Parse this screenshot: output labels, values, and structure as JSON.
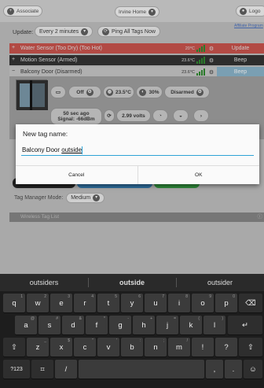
{
  "topbar": {
    "left_label": "Associate",
    "center_label": "Irvine Home",
    "right_label": "Logo"
  },
  "update_row": {
    "label": "Update:",
    "interval": "Every 2 minutes",
    "ping_button": "Ping All Tags Now",
    "link": "Affiliate Program"
  },
  "tags": [
    {
      "name": "Water Sensor (Too Dry) (Too Hot)",
      "temp": "20°C",
      "action": "Update",
      "color": "#b24a44"
    },
    {
      "name": "Motion Sensor (Armed)",
      "temp": "23.6°C",
      "action": "Beep",
      "color": "#2d2d2d"
    },
    {
      "name": "Balcony Door (Disarmed)",
      "temp": "23.6°C",
      "action": "Beep",
      "color": "#b0b0b0"
    }
  ],
  "detail": {
    "off_label": "Off",
    "temp": "23.5°C",
    "humidity": "30%",
    "disarmed": "Disarmed",
    "last_seen": "50 sec ago",
    "signal": "Signal: -66dBm",
    "volts": "2.99 volts"
  },
  "manager_mode": {
    "label": "Tag Manager Mode:",
    "value": "Medium"
  },
  "wireless_list": "Wireless Tag List",
  "dialog": {
    "title": "New tag name:",
    "value_prefix": "Balcony Door ",
    "value_underlined": "outside",
    "cancel": "Cancel",
    "ok": "OK"
  },
  "keyboard": {
    "suggestions": [
      "outsiders",
      "outside",
      "outsider"
    ],
    "row1": [
      {
        "k": "q",
        "h": "1"
      },
      {
        "k": "w",
        "h": "2"
      },
      {
        "k": "e",
        "h": "3"
      },
      {
        "k": "r",
        "h": "4"
      },
      {
        "k": "t",
        "h": "5"
      },
      {
        "k": "y",
        "h": "6"
      },
      {
        "k": "u",
        "h": "7"
      },
      {
        "k": "i",
        "h": "8"
      },
      {
        "k": "o",
        "h": "9"
      },
      {
        "k": "p",
        "h": "0"
      }
    ],
    "row2": [
      {
        "k": "a",
        "h": "@"
      },
      {
        "k": "s",
        "h": "#"
      },
      {
        "k": "d",
        "h": "&"
      },
      {
        "k": "f",
        "h": "*"
      },
      {
        "k": "g",
        "h": "-"
      },
      {
        "k": "h",
        "h": "+"
      },
      {
        "k": "j",
        "h": "="
      },
      {
        "k": "k",
        "h": "("
      },
      {
        "k": "l",
        "h": ")"
      }
    ],
    "row3": [
      {
        "k": "z",
        "h": "_"
      },
      {
        "k": "x",
        "h": "$"
      },
      {
        "k": "c",
        "h": "\""
      },
      {
        "k": "v",
        "h": "'"
      },
      {
        "k": "b",
        "h": ":"
      },
      {
        "k": "n",
        "h": ";"
      },
      {
        "k": "m",
        "h": "/"
      },
      {
        "k": "!",
        "h": ""
      },
      {
        "k": "?",
        "h": ""
      }
    ],
    "sym_label": "?123",
    "tab_label": "⌗",
    "slash_label": "/",
    "comma_label": ",",
    "period_label": ".",
    "shift_glyph": "⇧",
    "backspace_glyph": "⌫",
    "enter_glyph": "↵",
    "emoji_glyph": "☺"
  },
  "colors": {
    "accent": "#2ea3d6",
    "signal_green": "#2a7a2a"
  }
}
